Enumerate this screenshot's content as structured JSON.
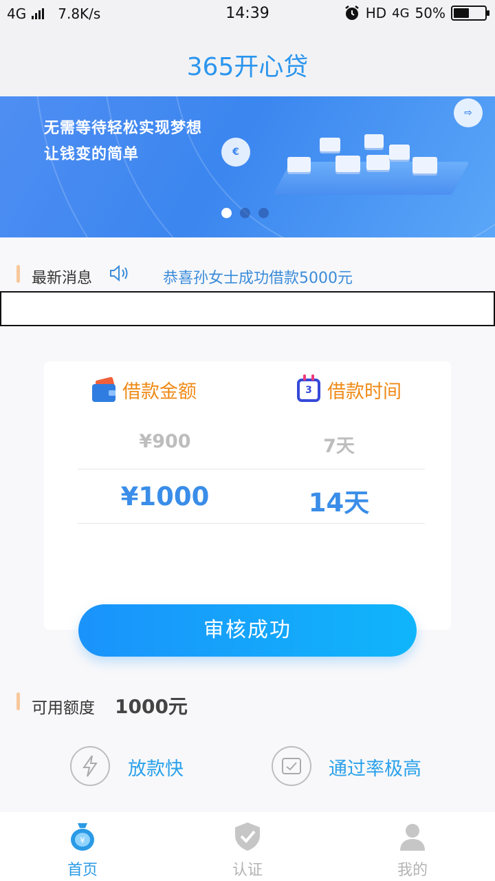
{
  "status_bar": {
    "network": "4G",
    "speed": "7.8K/s",
    "time": "14:39",
    "hd": "HD",
    "network_right": "4G",
    "battery": "50%",
    "battery_level": 0.5
  },
  "header": {
    "title": "365开心贷"
  },
  "banner": {
    "slogan_line1": "无需等待轻松实现梦想",
    "slogan_line2": "让钱变的简单",
    "slides_total": 3,
    "active_slide": 1
  },
  "news": {
    "label": "最新消息",
    "message": "恭喜孙女士成功借款5000元"
  },
  "loan": {
    "amount_label": "借款金额",
    "term_label": "借款时间",
    "calendar_number": "3",
    "amount_prev": "¥900",
    "amount_selected": "¥1000",
    "term_prev": "7天",
    "term_selected": "14天"
  },
  "cta": {
    "label": "审核成功"
  },
  "available": {
    "label": "可用额度",
    "value": "1000元"
  },
  "features": [
    {
      "label": "放款快",
      "icon": "lightning-icon"
    },
    {
      "label": "通过率极高",
      "icon": "card-check-icon"
    }
  ],
  "tabbar": {
    "items": [
      {
        "label": "首页",
        "icon": "money-bag-icon",
        "active": true
      },
      {
        "label": "认证",
        "icon": "shield-check-icon",
        "active": false
      },
      {
        "label": "我的",
        "icon": "user-icon",
        "active": false
      }
    ],
    "active_color": "#2a9ae6",
    "inactive_color": "#b3b3b3"
  },
  "colors": {
    "accent": "#2b95ee",
    "orange": "#ef8a17",
    "cta_start": "#1a93fb",
    "cta_end": "#10b5fb"
  }
}
